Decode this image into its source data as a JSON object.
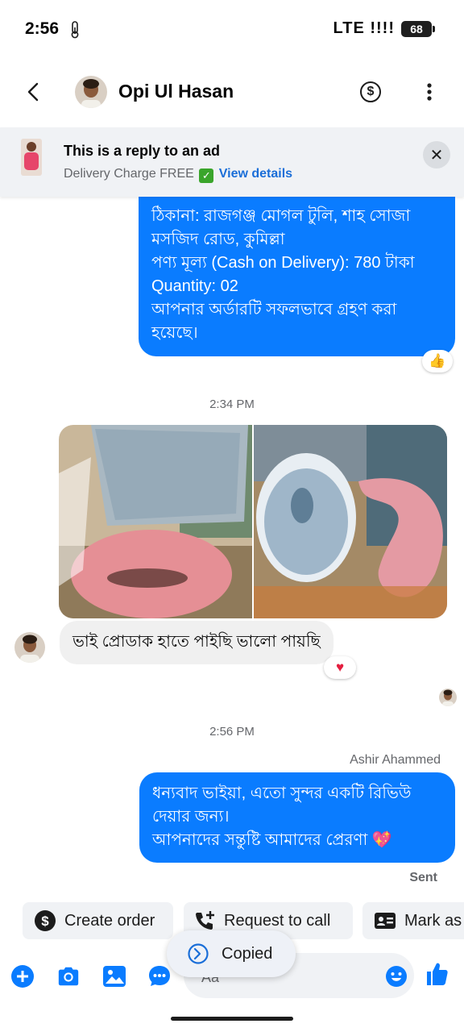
{
  "status_bar": {
    "time": "2:56",
    "network": "LTE",
    "signal": "!!!!",
    "battery": "68"
  },
  "header": {
    "contact_name": "Opi Ul Hasan"
  },
  "ad_banner": {
    "title": "This is a reply to an ad",
    "subtitle": "Delivery Charge FREE",
    "link": "View details"
  },
  "messages": {
    "order_confirmation": {
      "lines": [
        "ঠিকানা: রাজগঞ্জ মোগল টুলি, শাহ সোজা মসজিদ রোড, কুমিল্লা",
        "পণ্য মূল্য (Cash on Delivery): 780 টাকা",
        "Quantity: 02",
        "আপনার অর্ডারটি সফলভাবে গ্রহণ করা হয়েছে।"
      ],
      "reaction": "👍"
    },
    "time_1": "2:34 PM",
    "incoming_text": "ভাই প্রোডাক হাতে পাইছি ভালো পায়ছি",
    "incoming_reaction": "♥",
    "time_2": "2:56 PM",
    "sender_name": "Ashir Ahammed",
    "reply": {
      "line1": "ধন্যবাদ ভাইয়া, এতো সুন্দর একটি রিভিউ দেয়ার জন্য।",
      "line2": "আপনাদের সন্তুষ্টি আমাদের প্রেরণা 💖"
    },
    "status": "Sent"
  },
  "quick_actions": [
    {
      "label": "Create order",
      "icon": "dollar-circle-icon"
    },
    {
      "label": "Request to call",
      "icon": "phone-plus-icon"
    },
    {
      "label": "Mark as",
      "icon": "contact-card-icon"
    }
  ],
  "composer": {
    "placeholder": "Aa"
  },
  "toast": {
    "text": "Copied"
  },
  "colors": {
    "accent": "#0a7cff",
    "incoming_bubble": "#f0f0f0",
    "banner_bg": "#f0f2f5"
  }
}
